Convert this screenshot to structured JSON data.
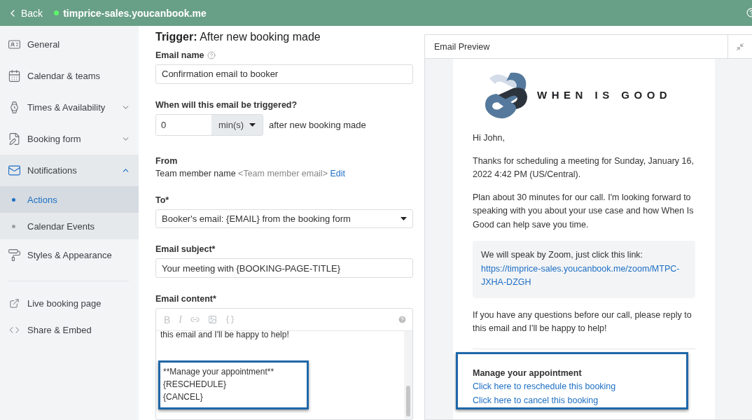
{
  "topbar": {
    "back": "Back",
    "site": "timprice-sales.youcanbook.me",
    "online": true
  },
  "sidebar": {
    "items": [
      {
        "label": "General"
      },
      {
        "label": "Calendar & teams"
      },
      {
        "label": "Times & Availability",
        "expanded": false
      },
      {
        "label": "Booking form",
        "expanded": false
      },
      {
        "label": "Notifications",
        "expanded": true,
        "children": [
          {
            "label": "Actions",
            "selected": true
          },
          {
            "label": "Calendar Events",
            "selected": false
          }
        ]
      },
      {
        "label": "Styles & Appearance"
      }
    ],
    "links": [
      {
        "label": "Live booking page"
      },
      {
        "label": "Share & Embed"
      }
    ]
  },
  "form": {
    "trigger_label": "Trigger:",
    "trigger_value": "After new booking made",
    "email_name": {
      "label": "Email name",
      "value": "Confirmation email to booker"
    },
    "timing": {
      "label": "When will this email be triggered?",
      "value": "0",
      "unit": "min(s)",
      "suffix": "after new booking made"
    },
    "from": {
      "label": "From",
      "name": "Team member name",
      "email": "<Team member email>",
      "edit": "Edit"
    },
    "to": {
      "label": "To*",
      "value": "Booker's email: {EMAIL} from the booking form"
    },
    "subject": {
      "label": "Email subject*",
      "value": "Your meeting with {BOOKING-PAGE-TITLE}"
    },
    "content": {
      "label": "Email content*",
      "toolbar": [
        "B",
        "I"
      ],
      "lines": [
        "this email and I'll be happy to help!"
      ],
      "highlighted_lines": [
        "**Manage your appointment**",
        "{RESCHEDULE}",
        "{CANCEL}"
      ]
    }
  },
  "preview": {
    "title": "Email Preview",
    "logo_text": "WHEN IS GOOD",
    "greeting": "Hi John,",
    "paragraphs": [
      "Thanks for scheduling a meeting for Sunday, January 16, 2022 4:42 PM (US/Central).",
      "Plan about 30 minutes for our call. I'm looking forward to speaking with you about your use case and how When Is Good can help save you time."
    ],
    "zoom_text": "We will speak by Zoom, just click this link:",
    "zoom_link": "https://timprice-sales.youcanbook.me/zoom/MTPC-JXHA-DZGH",
    "closing": "If you have any questions before our call, please reply to this email and I'll be happy to help!",
    "manage_title": "Manage your appointment",
    "manage_links": [
      "Click here to reschedule this booking",
      "Click here to cancel this booking"
    ]
  }
}
